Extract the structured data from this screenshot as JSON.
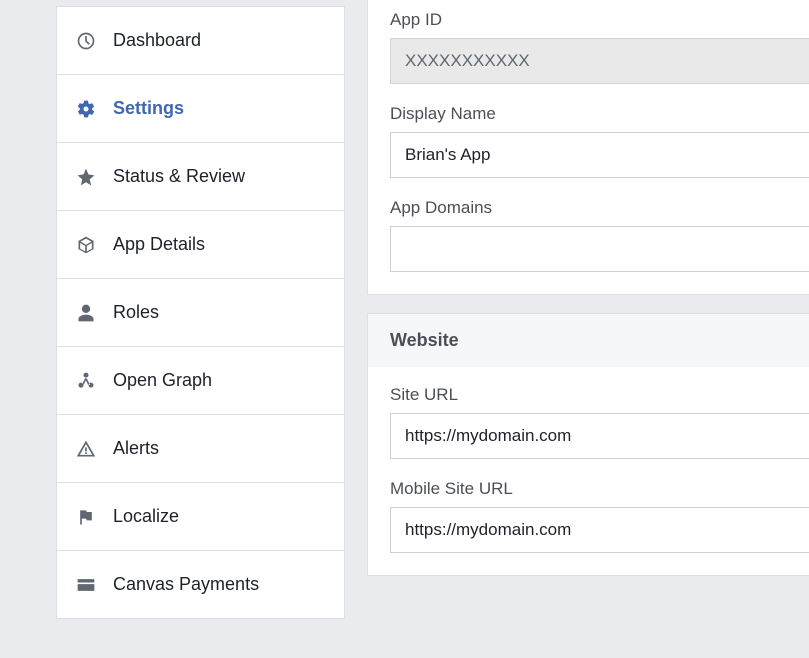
{
  "sidebar": {
    "items": [
      {
        "id": "dashboard",
        "label": "Dashboard"
      },
      {
        "id": "settings",
        "label": "Settings"
      },
      {
        "id": "status-review",
        "label": "Status & Review"
      },
      {
        "id": "app-details",
        "label": "App Details"
      },
      {
        "id": "roles",
        "label": "Roles"
      },
      {
        "id": "open-graph",
        "label": "Open Graph"
      },
      {
        "id": "alerts",
        "label": "Alerts"
      },
      {
        "id": "localize",
        "label": "Localize"
      },
      {
        "id": "canvas-payments",
        "label": "Canvas Payments"
      }
    ]
  },
  "form": {
    "app_id": {
      "label": "App ID",
      "value": "XXXXXXXXXXX"
    },
    "display_name": {
      "label": "Display Name",
      "value": "Brian's App"
    },
    "app_domains": {
      "label": "App Domains",
      "value": ""
    }
  },
  "website": {
    "header": "Website",
    "site_url": {
      "label": "Site URL",
      "value": "https://mydomain.com"
    },
    "mobile_site_url": {
      "label": "Mobile Site URL",
      "value": "https://mydomain.com"
    }
  }
}
